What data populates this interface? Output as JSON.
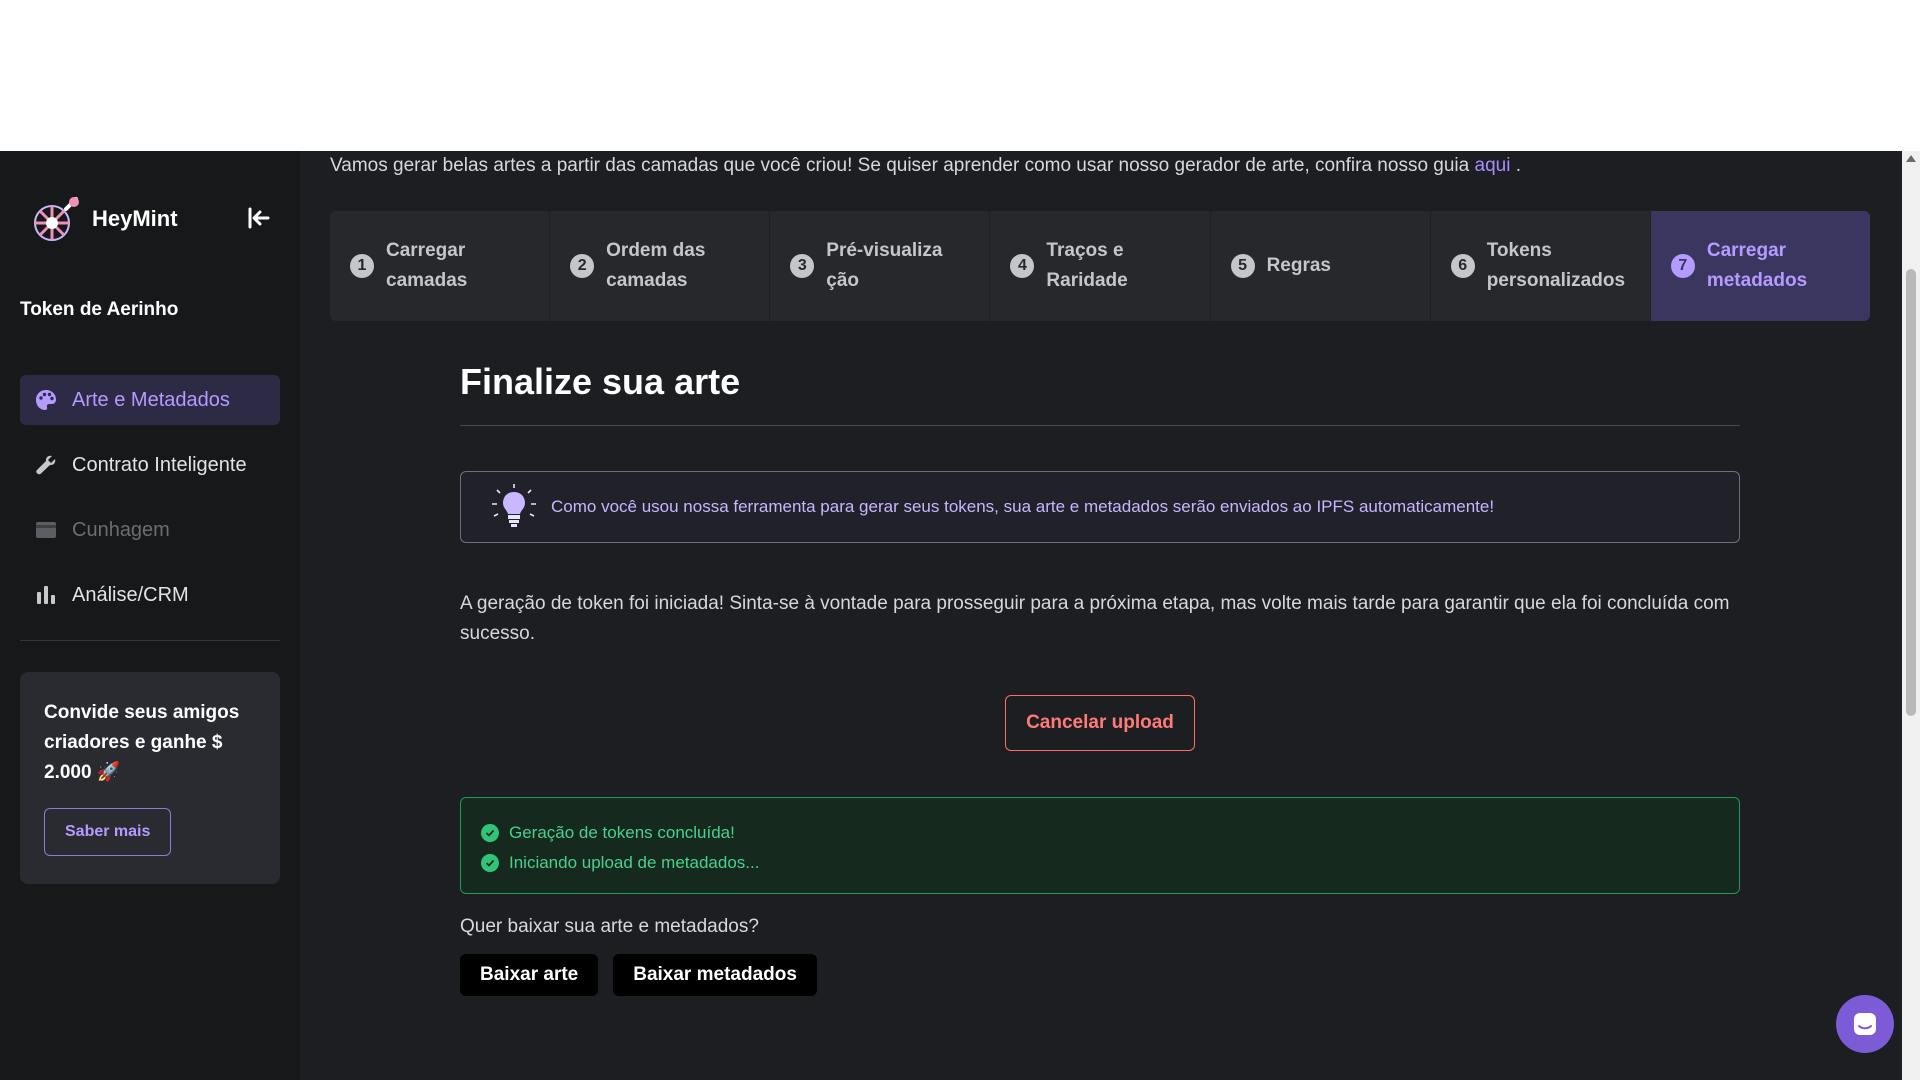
{
  "brand": {
    "name": "HeyMint"
  },
  "project": {
    "name": "Token de Aerinho"
  },
  "sidebar": {
    "items": [
      {
        "label": "Arte e Metadados",
        "icon": "palette-icon",
        "state": "active"
      },
      {
        "label": "Contrato Inteligente",
        "icon": "wrench-icon",
        "state": "normal"
      },
      {
        "label": "Cunhagem",
        "icon": "card-icon",
        "state": "disabled"
      },
      {
        "label": "Análise/CRM",
        "icon": "bar-chart-icon",
        "state": "normal"
      }
    ],
    "invite": {
      "text": "Convide seus amigos criadores e ganhe $ 2.000 🚀",
      "button": "Saber mais"
    }
  },
  "intro": {
    "text": "Vamos gerar belas artes a partir das camadas que você criou! Se quiser aprender como usar nosso gerador de arte, confira nosso guia ",
    "link": "aqui",
    "tail": " ."
  },
  "steps": [
    {
      "num": "1",
      "label": "Carregar camadas"
    },
    {
      "num": "2",
      "label": "Ordem das camadas"
    },
    {
      "num": "3",
      "label": "Pré-visualização"
    },
    {
      "num": "4",
      "label": "Traços e Raridade"
    },
    {
      "num": "5",
      "label": "Regras"
    },
    {
      "num": "6",
      "label": "Tokens personalizados"
    },
    {
      "num": "7",
      "label": "Carregar metadados"
    }
  ],
  "main": {
    "title": "Finalize sua arte",
    "info": "Como você usou nossa ferramenta para gerar seus tokens, sua arte e metadados serão enviados ao IPFS automaticamente!",
    "paragraph": "A geração de token foi iniciada! Sinta-se à vontade para prosseguir para a próxima etapa, mas volte mais tarde para garantir que ela foi concluída com sucesso.",
    "cancel_button": "Cancelar upload",
    "status": [
      "Geração de tokens concluída!",
      "Iniciando upload de metadados..."
    ],
    "question": "Quer baixar sua arte e metadados?",
    "download_art": "Baixar arte",
    "download_metadata": "Baixar metadados"
  },
  "colors": {
    "accent": "#b49bff",
    "success": "#2fc477",
    "danger": "#ff6b6b"
  }
}
